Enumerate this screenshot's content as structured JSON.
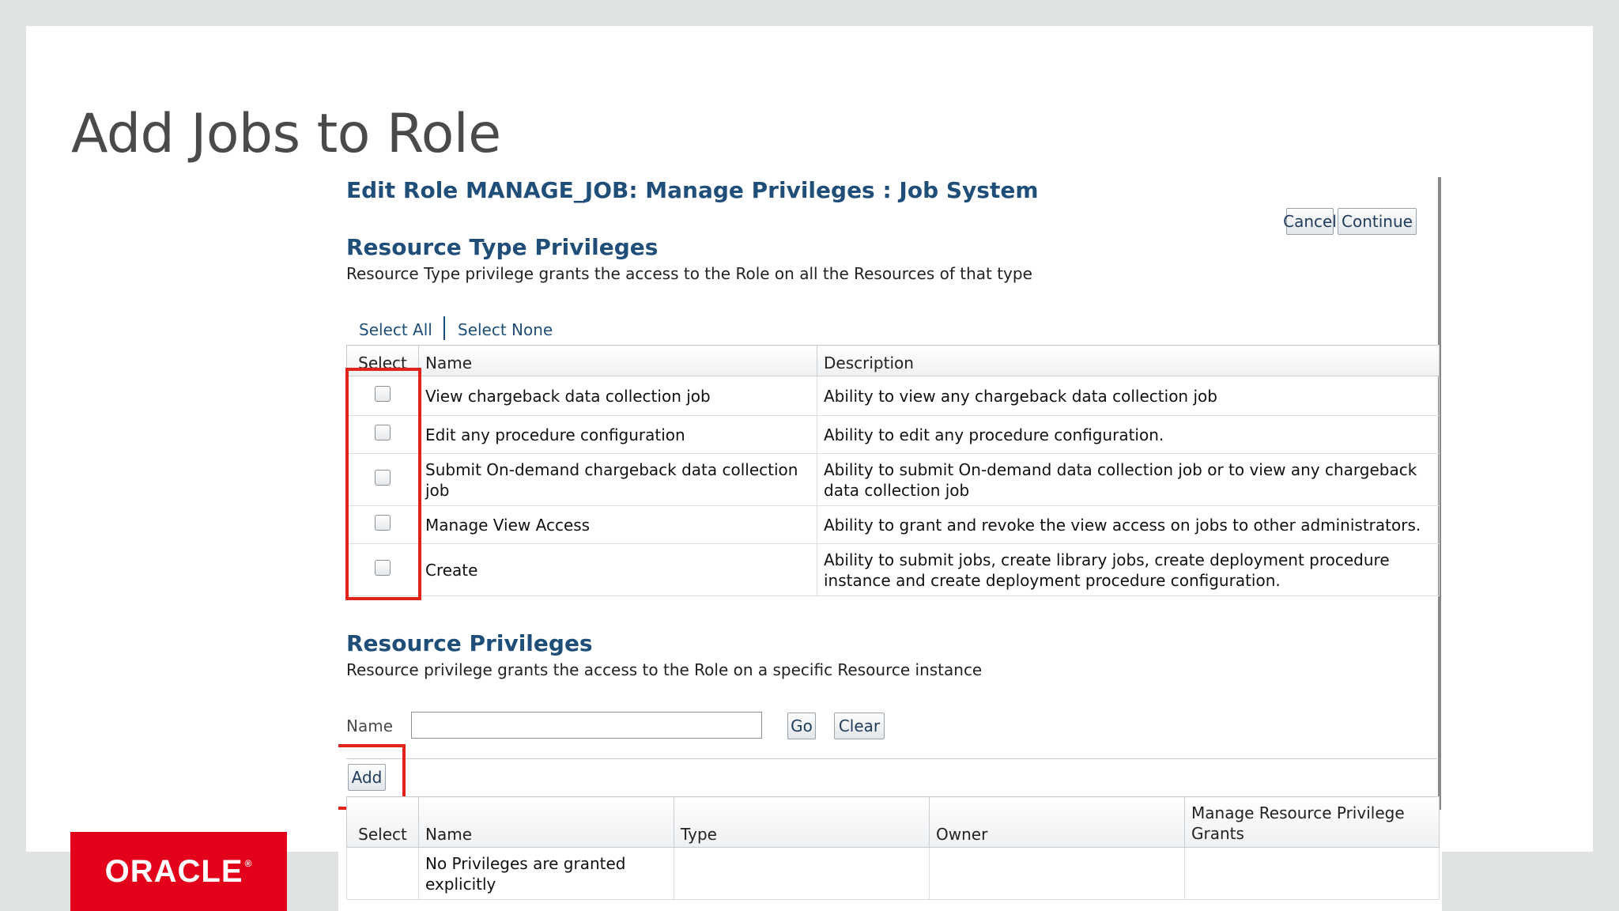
{
  "slide": {
    "title": "Add Jobs to Role",
    "logo_text": "ORACLE"
  },
  "page": {
    "title": "Edit Role MANAGE_JOB: Manage Privileges : Job System",
    "buttons": {
      "cancel": "Cancel",
      "continue": "Continue"
    }
  },
  "resource_type": {
    "title": "Resource Type Privileges",
    "description": "Resource Type privilege grants the access to the Role on all the Resources of that type",
    "select_all": "Select All",
    "select_none": "Select None",
    "columns": [
      "Select",
      "Name",
      "Description"
    ],
    "rows": [
      {
        "name": "View chargeback data collection job",
        "description": "Ability to view any chargeback data collection job",
        "checked": false
      },
      {
        "name": "Edit any procedure configuration",
        "description": "Ability to edit any procedure configuration.",
        "checked": false
      },
      {
        "name": "Submit On-demand chargeback data collection job",
        "description": "Ability to submit On-demand data collection job or to view any chargeback data collection job",
        "checked": false
      },
      {
        "name": "Manage View Access",
        "description": "Ability to grant and revoke the view access on jobs to other administrators.",
        "checked": false
      },
      {
        "name": "Create",
        "description": "Ability to submit jobs, create library jobs, create deployment procedure instance and create deployment procedure configuration.",
        "checked": false
      }
    ]
  },
  "resource": {
    "title": "Resource Privileges",
    "description": "Resource privilege grants the access to the Role on a specific Resource instance",
    "search": {
      "label": "Name",
      "value": "",
      "go": "Go",
      "clear": "Clear"
    },
    "add": "Add",
    "columns": [
      "Select",
      "Name",
      "Type",
      "Owner",
      "Manage Resource Privilege Grants"
    ],
    "empty_message": "No Privileges are granted explicitly"
  },
  "colors": {
    "accent": "#1f4e79",
    "highlight": "#e2231a",
    "oracle_red": "#e2001a"
  }
}
